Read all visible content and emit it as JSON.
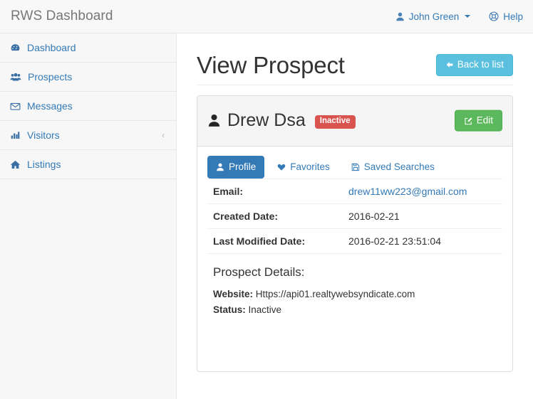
{
  "navbar": {
    "brand": "RWS Dashboard",
    "user_menu": {
      "label": "John Green",
      "icon": "user-icon"
    },
    "help": {
      "label": "Help",
      "icon": "life-ring-icon"
    }
  },
  "sidebar": {
    "items": [
      {
        "label": "Dashboard",
        "icon": "tachometer-icon",
        "chevron": ""
      },
      {
        "label": "Prospects",
        "icon": "users-icon",
        "chevron": ""
      },
      {
        "label": "Messages",
        "icon": "envelope-icon",
        "chevron": ""
      },
      {
        "label": "Visitors",
        "icon": "bar-chart-icon",
        "chevron": "‹"
      },
      {
        "label": "Listings",
        "icon": "home-icon",
        "chevron": ""
      }
    ]
  },
  "page": {
    "title": "View Prospect",
    "back_button": {
      "label": "Back to list",
      "icon": "arrow-left-icon"
    }
  },
  "panel": {
    "prospect_name": "Drew Dsa",
    "status_badge": "Inactive",
    "edit_button": {
      "label": "Edit",
      "icon": "pencil-square-icon"
    },
    "tabs": [
      {
        "label": "Profile",
        "icon": "user-icon",
        "active": true
      },
      {
        "label": "Favorites",
        "icon": "heart-icon",
        "active": false
      },
      {
        "label": "Saved Searches",
        "icon": "save-icon",
        "active": false
      }
    ],
    "fields": [
      {
        "key": "Email:",
        "value": "drew11ww223@gmail.com",
        "is_link": true
      },
      {
        "key": "Created Date:",
        "value": "2016-02-21",
        "is_link": false
      },
      {
        "key": "Last Modified Date:",
        "value": "2016-02-21 23:51:04",
        "is_link": false
      }
    ],
    "details_heading": "Prospect Details:",
    "details": [
      {
        "key": "Website:",
        "value": "Https://api01.realtywebsyndicate.com"
      },
      {
        "key": "Status:",
        "value": "Inactive"
      }
    ]
  },
  "colors": {
    "brand_link": "#337ab7",
    "info": "#5bc0de",
    "success": "#5cb85c",
    "danger": "#d9534f",
    "navbar_bg": "#f8f8f8",
    "sidebar_bg": "#f7f7f7"
  }
}
